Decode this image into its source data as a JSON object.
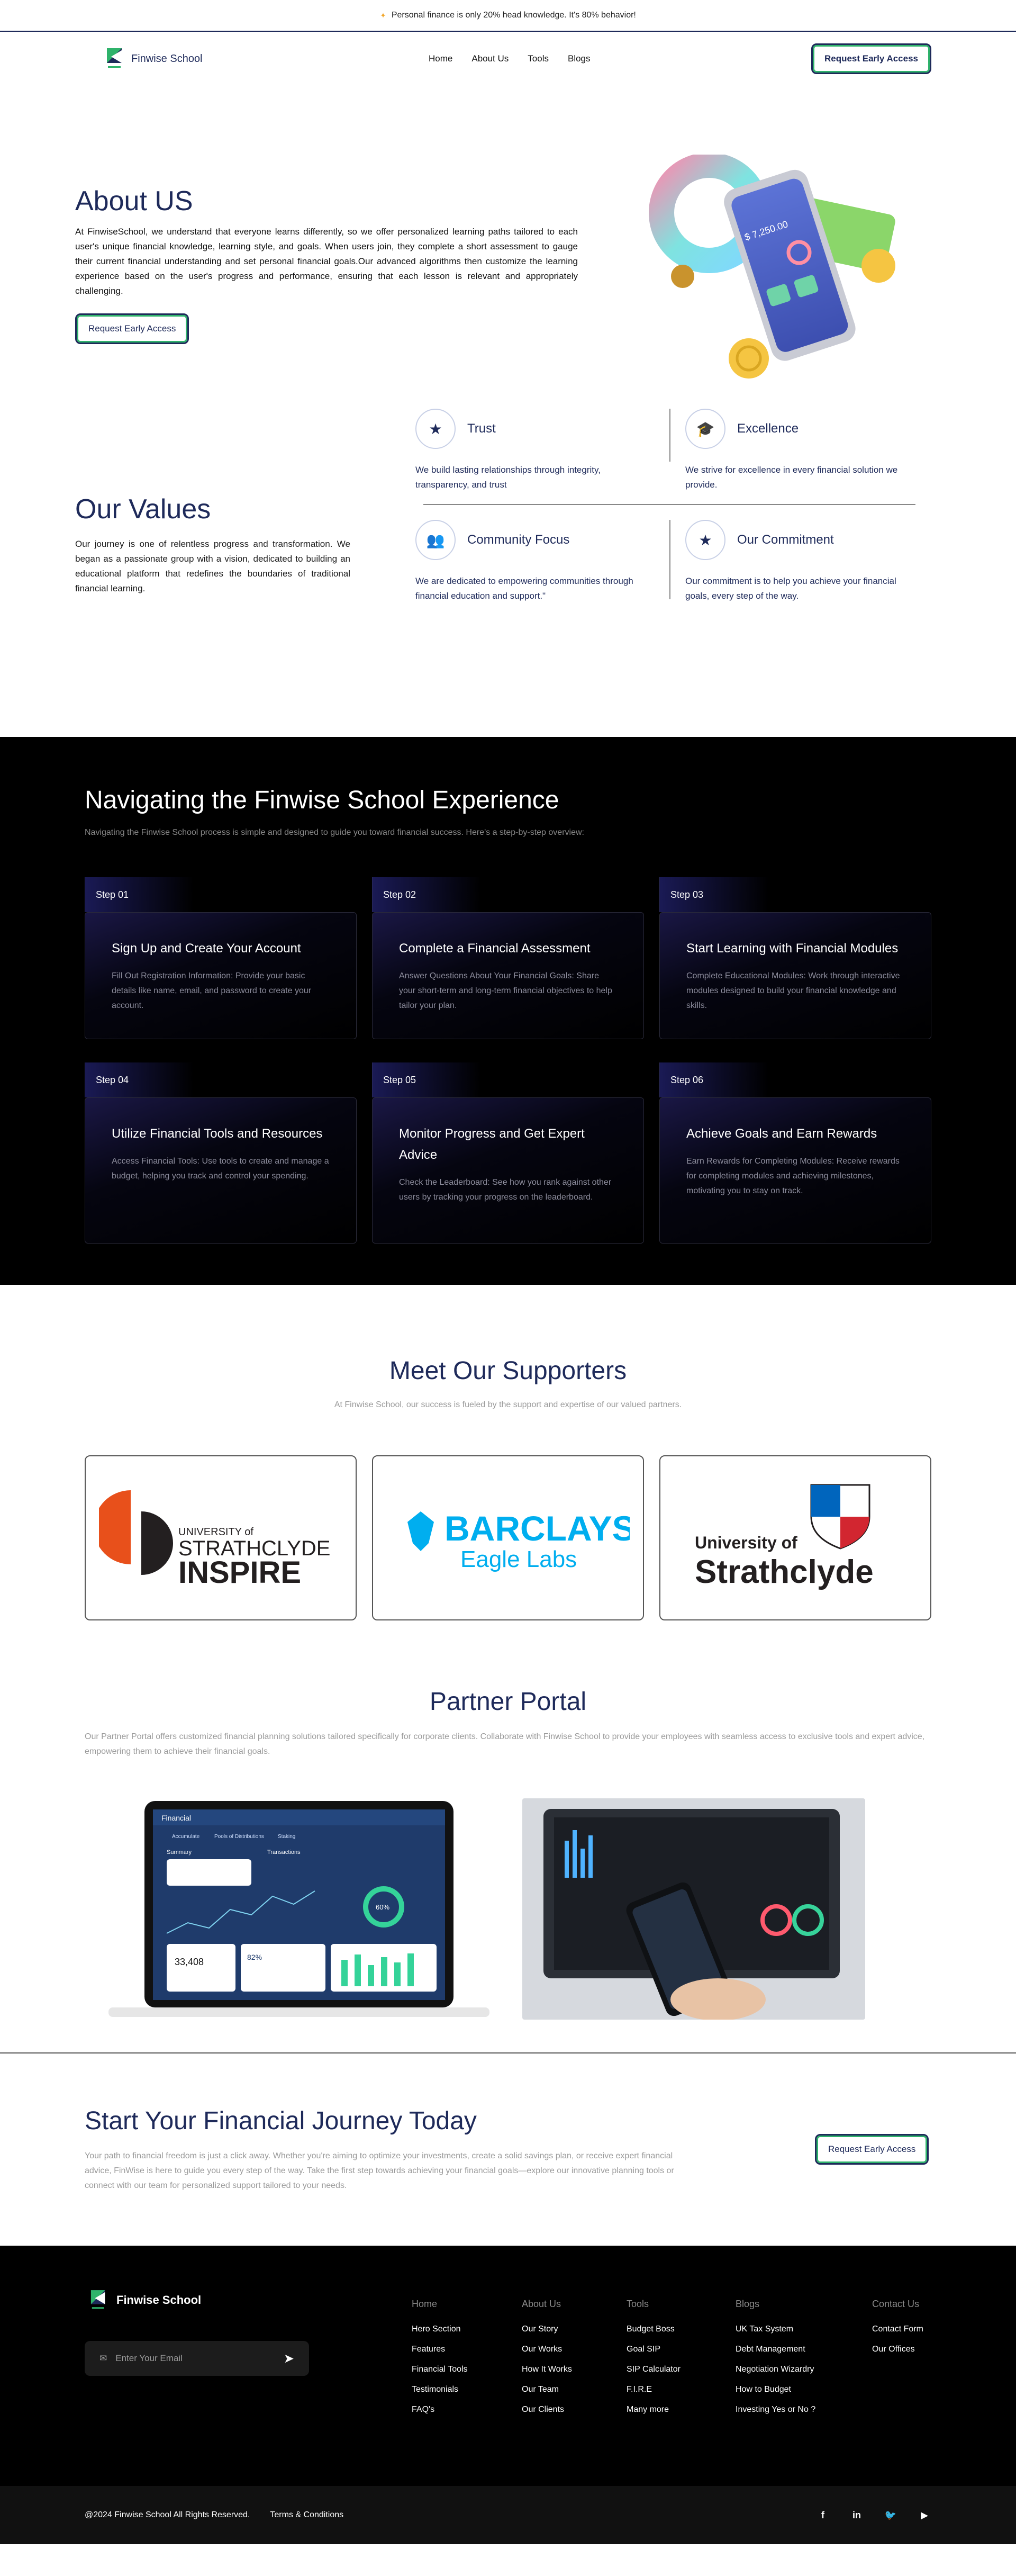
{
  "banner": {
    "text": "Personal finance is only 20% head knowledge. It's 80% behavior!"
  },
  "header": {
    "logo_text": "Finwise School",
    "nav": [
      "Home",
      "About Us",
      "Tools",
      "Blogs"
    ],
    "cta": "Request Early Access"
  },
  "about": {
    "title": "About US",
    "body": "At FinwiseSchool, we understand that everyone learns differently, so we offer personalized learning paths tailored to each user's unique financial knowledge, learning style, and goals. When users join, they complete a short assessment to gauge their current financial understanding and set personal financial goals.Our advanced algorithms then customize the learning experience based on the user's progress and performance, ensuring that each lesson is relevant and appropriately challenging.",
    "cta": "Request Early Access",
    "phone_amount": "$ 7,250.00"
  },
  "values": {
    "title": "Our Values",
    "body": "Our journey is one of relentless progress and transformation. We began as a passionate group with a vision, dedicated to building an educational platform that redefines the boundaries of traditional financial learning.",
    "items": [
      {
        "title": "Trust",
        "text": "We build lasting relationships through integrity, transparency, and trust",
        "icon": "star-icon"
      },
      {
        "title": "Excellence",
        "text": "We strive for excellence in every financial solution we provide.",
        "icon": "graduation-cap-icon"
      },
      {
        "title": "Community Focus",
        "text": "We are dedicated to empowering communities through financial education and support.\"",
        "icon": "community-icon"
      },
      {
        "title": "Our Commitment",
        "text": "Our commitment is to help you achieve your financial goals, every step of the way.",
        "icon": "star-icon"
      }
    ]
  },
  "steps": {
    "title": "Navigating the Finwise School Experience",
    "subtitle": "Navigating the Finwise School process is simple and designed to guide you toward financial success. Here's a step-by-step overview:",
    "items": [
      {
        "no": "Step 01",
        "title": "Sign Up and Create Your Account",
        "text": "Fill Out Registration Information: Provide your basic details like name, email, and password to create your account."
      },
      {
        "no": "Step 02",
        "title": "Complete a Financial Assessment",
        "text": "Answer Questions About Your Financial Goals: Share your short-term and long-term financial objectives to help tailor your plan."
      },
      {
        "no": "Step 03",
        "title": "Start Learning with Financial Modules",
        "text": "Complete Educational Modules: Work through interactive modules designed to build your financial knowledge and skills."
      },
      {
        "no": "Step 04",
        "title": "Utilize Financial Tools and Resources",
        "text": "Access Financial Tools: Use tools to create and manage a budget, helping you track and control your spending."
      },
      {
        "no": "Step 05",
        "title": "Monitor Progress and Get Expert Advice",
        "text": "Check the Leaderboard: See how you rank against other users by tracking your progress on the leaderboard."
      },
      {
        "no": "Step 06",
        "title": "Achieve Goals and Earn Rewards",
        "text": "Earn Rewards for Completing Modules: Receive rewards for completing modules and achieving milestones, motivating you to stay on track."
      }
    ]
  },
  "supporters": {
    "title": "Meet Our Supporters",
    "subtitle": "At Finwise School, our success is fueled by the support and expertise of our valued partners.",
    "logos": [
      {
        "line1": "UNIVERSITY of",
        "line2": "STRATHCLYDE",
        "line3": "INSPIRE"
      },
      {
        "line1": "BARCLAYS",
        "line2": "Eagle Labs"
      },
      {
        "line1": "University of",
        "line2": "Strathclyde"
      }
    ]
  },
  "partner": {
    "title": "Partner Portal",
    "body": "Our Partner Portal offers customized financial planning solutions tailored specifically for corporate clients. Collaborate with Finwise School to provide your employees with seamless access to exclusive tools and expert advice, empowering them to achieve their financial goals.",
    "dash": {
      "title": "Financial",
      "pill1": "Accumulate",
      "pill2": "Pools of Distributions",
      "pill3": "Staking",
      "summary": "Summary",
      "transactions": "Transactions",
      "balance": "33,408",
      "pct": "82%",
      "gauge": "60%"
    }
  },
  "cta": {
    "title": "Start Your Financial Journey Today",
    "body": "Your path to financial freedom is just a click away. Whether you're aiming to optimize your investments, create a solid savings plan, or receive expert financial advice, FinWise is here to guide you every step of the way. Take the first step towards achieving your financial goals—explore our innovative planning tools or connect with our team for personalized support tailored to your needs.",
    "button": "Request Early Access"
  },
  "footer": {
    "logo_text": "Finwise School",
    "email_placeholder": "Enter Your Email",
    "columns": [
      {
        "heading": "Home",
        "items": [
          "Hero Section",
          "Features",
          "Financial Tools",
          "Testimonials",
          "FAQ's"
        ]
      },
      {
        "heading": "About Us",
        "items": [
          "Our Story",
          "Our Works",
          "How It Works",
          "Our Team",
          "Our Clients"
        ]
      },
      {
        "heading": "Tools",
        "items": [
          "Budget Boss",
          "Goal SIP",
          "SIP Calculator",
          "F.I.R.E",
          "Many more"
        ]
      },
      {
        "heading": "Blogs",
        "items": [
          "UK Tax System",
          "Debt Management",
          "Negotiation Wizardry",
          "How to Budget",
          "Investing Yes or No ?"
        ]
      },
      {
        "heading": "Contact Us",
        "items": [
          "Contact Form",
          "Our Offices"
        ]
      }
    ],
    "copyright": "@2024 Finwise School All Rights Reserved.",
    "terms": "Terms & Conditions",
    "socials": [
      "facebook-icon",
      "linkedin-icon",
      "twitter-icon",
      "youtube-icon"
    ]
  },
  "colors": {
    "navy": "#1e2a5a",
    "green": "#2fb36b",
    "black": "#000000",
    "muted": "#9a9a9a"
  }
}
